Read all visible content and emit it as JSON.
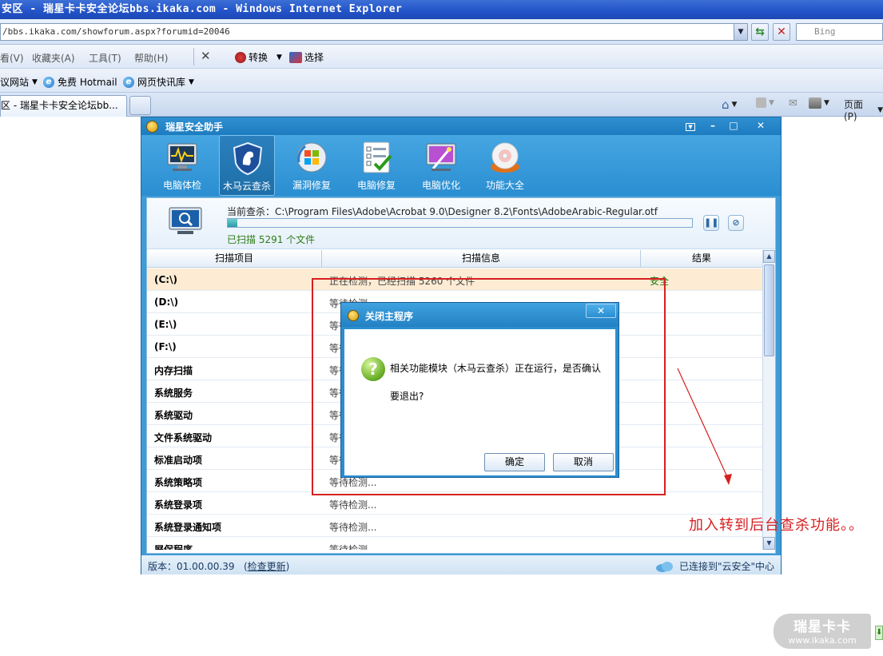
{
  "browser": {
    "title": "安区 - 瑞星卡卡安全论坛bbs.ikaka.com - Windows Internet Explorer",
    "address": "/bbs.ikaka.com/showforum.aspx?forumid=20046",
    "search_placeholder": "Bing",
    "menu": [
      "看(V)",
      "收藏夹(A)",
      "工具(T)",
      "帮助(H)"
    ],
    "toolbar": {
      "convert_label": "转换",
      "select_label": "选择"
    },
    "favorites": [
      "议网站",
      "免费 Hotmail",
      "网页快讯库"
    ],
    "tab_label": "区 - 瑞星卡卡安全论坛bb...",
    "page_menu": "页面(P)"
  },
  "app": {
    "title": "瑞星安全助手",
    "tools": [
      {
        "label": "电脑体检",
        "icon": "monitor-checkup-icon"
      },
      {
        "label": "木马云查杀",
        "icon": "shield-horse-icon"
      },
      {
        "label": "漏洞修复",
        "icon": "windows-repair-icon"
      },
      {
        "label": "电脑修复",
        "icon": "checklist-icon"
      },
      {
        "label": "电脑优化",
        "icon": "wand-optimize-icon"
      },
      {
        "label": "功能大全",
        "icon": "disc-tools-icon"
      }
    ],
    "active_tool": "木马云查杀",
    "scan": {
      "current_path": "当前查杀：C:\\Program Files\\Adobe\\Acrobat 9.0\\Designer 8.2\\Fonts\\AdobeArabic-Regular.otf",
      "progress": 0.02,
      "scanned_text": "已扫描 5291 个文件"
    },
    "table": {
      "headers": [
        "扫描项目",
        "扫描信息",
        "结果"
      ],
      "rows": [
        {
          "item": "(C:\\)",
          "info": "正在检测，已经扫描 5260 个文件",
          "result": "安全"
        },
        {
          "item": "(D:\\)",
          "info": "等待检测...",
          "result": ""
        },
        {
          "item": "(E:\\)",
          "info": "等待检测...",
          "result": ""
        },
        {
          "item": "(F:\\)",
          "info": "等待检测...",
          "result": ""
        },
        {
          "item": "内存扫描",
          "info": "等待检测...",
          "result": ""
        },
        {
          "item": "系统服务",
          "info": "等待检测...",
          "result": ""
        },
        {
          "item": "系统驱动",
          "info": "等待检测...",
          "result": ""
        },
        {
          "item": "文件系统驱动",
          "info": "等待检测...",
          "result": ""
        },
        {
          "item": "标准启动项",
          "info": "等待检测...",
          "result": ""
        },
        {
          "item": "系统策略项",
          "info": "等待检测...",
          "result": ""
        },
        {
          "item": "系统登录项",
          "info": "等待检测...",
          "result": ""
        },
        {
          "item": "系统登录通知项",
          "info": "等待检测...",
          "result": ""
        },
        {
          "item": "屏保程序",
          "info": "等待检测...",
          "result": ""
        }
      ]
    },
    "status": {
      "version_text": "版本：01.00.00.39",
      "update_link": "检查更新",
      "cloud_text": "已连接到\"云安全\"中心"
    }
  },
  "dialog": {
    "title": "关闭主程序",
    "message_line1": "相关功能模块（木马云查杀）正在运行，是否确认",
    "message_line2": "要退出?",
    "ok_label": "确定",
    "cancel_label": "取消"
  },
  "annotation": {
    "text": "加入转到后台查杀功能。。",
    "color": "#d62020"
  },
  "watermark": {
    "brand": "瑞星卡卡",
    "url": "www.ikaka.com"
  },
  "colors": {
    "app_blue": "#2a8ed1",
    "safe_green": "#2b7c14",
    "highlight_row": "#fdebd4"
  }
}
